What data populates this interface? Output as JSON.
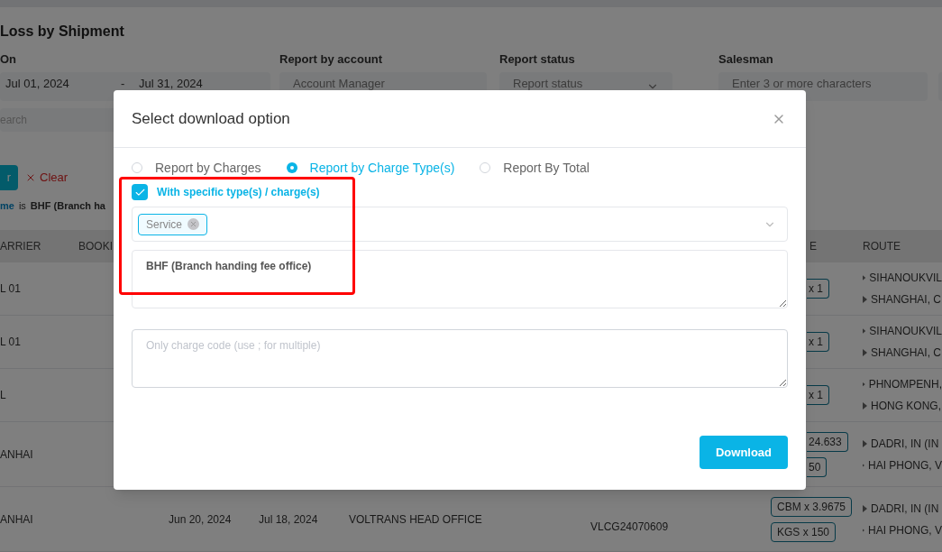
{
  "page": {
    "title": "Loss by Shipment",
    "filters": [
      {
        "label": "On",
        "kind": "daterange",
        "from": "Jul 01, 2024",
        "separator": "-",
        "to": "Jul 31, 2024"
      },
      {
        "label": "Report by account",
        "kind": "text",
        "placeholder": "Account Manager"
      },
      {
        "label": "Report status",
        "kind": "select",
        "placeholder": "Report status"
      },
      {
        "label": "Salesman",
        "kind": "text",
        "placeholder": "Enter 3 or more characters"
      },
      {
        "kind": "text"
      }
    ],
    "search": {
      "placeholder": "earch"
    },
    "apply_button": "r",
    "clear_button": "Clear",
    "active_filter": {
      "field": "me",
      "operator": "is",
      "value": "BHF (Branch ha"
    }
  },
  "table": {
    "columns": [
      "ARRIER",
      "BOOKI",
      "E",
      "ROUTE"
    ],
    "rows": [
      {
        "carrier": "L 01",
        "volume": [
          "x 1"
        ],
        "route": [
          "SIHANOUKVIL",
          "SHANGHAI, C"
        ]
      },
      {
        "carrier": "L 01",
        "volume": [
          "x 1"
        ],
        "route": [
          "SIHANOUKVIL",
          "SHANGHAI, C"
        ]
      },
      {
        "carrier": "L",
        "volume": [
          "x 1"
        ],
        "route": [
          "PHNOMPENH,",
          "HONG KONG,"
        ]
      },
      {
        "carrier": "ANHAI",
        "volume": [
          "24.633",
          "50"
        ],
        "route": [
          "DADRI, IN (IN",
          "HAI PHONG, V"
        ]
      },
      {
        "carrier": "ANHAI",
        "etd": "Jun 20, 2024",
        "eta": "Jul 18, 2024",
        "office": "VOLTRANS HEAD OFFICE",
        "code": "VLCG24070609",
        "volume": [
          "CBM x 3.9675",
          "KGS x 150"
        ],
        "route": [
          "DADRI, IN (IN",
          "HAI PHONG, V"
        ]
      }
    ]
  },
  "dialog": {
    "title": "Select download option",
    "options": [
      {
        "label": "Report by Charges",
        "selected": false
      },
      {
        "label": "Report by Charge Type(s)",
        "selected": true
      },
      {
        "label": "Report By Total",
        "selected": false
      }
    ],
    "specific": {
      "label": "With specific type(s) / charge(s)",
      "checked": true
    },
    "types": {
      "tags": [
        "Service"
      ]
    },
    "charges": {
      "value": "BHF (Branch handing fee office)"
    },
    "codes": {
      "placeholder": "Only charge code (use ; for multiple)"
    },
    "button": "Download"
  }
}
